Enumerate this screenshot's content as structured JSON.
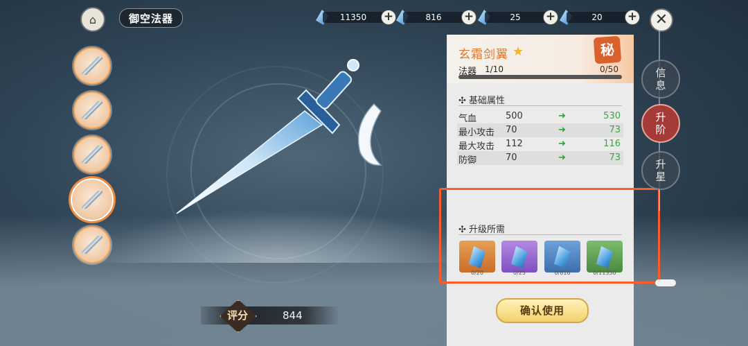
{
  "header": {
    "title": "御空法器",
    "home_icon": "palace-icon",
    "close_icon": "close-icon"
  },
  "currencies": [
    {
      "icon": "blue-crystal-icon",
      "value": "11350"
    },
    {
      "icon": "blue-shard-icon",
      "value": "816"
    },
    {
      "icon": "crystal-cluster-icon",
      "value": "25"
    },
    {
      "icon": "dark-crystal-icon",
      "value": "20"
    }
  ],
  "item_list": [
    {
      "name": "item-1",
      "selected": false
    },
    {
      "name": "item-2",
      "selected": false
    },
    {
      "name": "item-3",
      "selected": false
    },
    {
      "name": "item-4",
      "selected": true
    },
    {
      "name": "item-5",
      "selected": false
    }
  ],
  "score": {
    "label": "评分",
    "value": "844"
  },
  "detail": {
    "name": "玄霜剑翼",
    "seal": "秘",
    "category": "法器",
    "level": "1/10",
    "progress_text": "0/50",
    "progress": 0,
    "base_title": "基础属性",
    "stats": [
      {
        "name": "气血",
        "cur": "500",
        "next": "530"
      },
      {
        "name": "最小攻击",
        "cur": "70",
        "next": "73"
      },
      {
        "name": "最大攻击",
        "cur": "112",
        "next": "116"
      },
      {
        "name": "防御",
        "cur": "70",
        "next": "73"
      }
    ],
    "arrow": "➜",
    "upgrade_title": "升级所需",
    "materials": [
      {
        "count": "0/20",
        "bg": "#d98a3d"
      },
      {
        "count": "0/25",
        "bg": "#9a6ad0"
      },
      {
        "count": "0/816",
        "bg": "#4f86c4"
      },
      {
        "count": "0/11350",
        "bg": "#5e9e52"
      }
    ],
    "confirm": "确认使用"
  },
  "tabs": [
    {
      "label": "信息",
      "active": false
    },
    {
      "label": "升阶",
      "active": true
    },
    {
      "label": "升星",
      "active": false
    }
  ]
}
